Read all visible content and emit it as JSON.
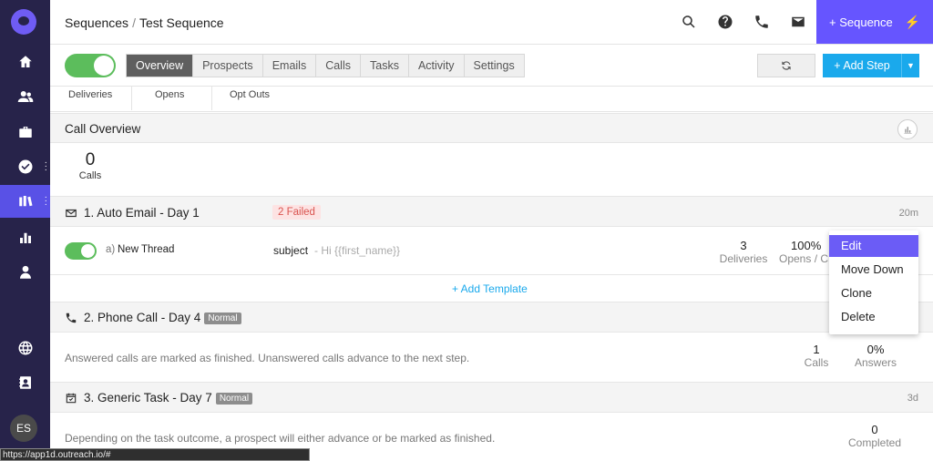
{
  "breadcrumb": {
    "parent": "Sequences",
    "separator": "/",
    "current": "Test Sequence"
  },
  "topbar": {
    "sequence_button": "+ Sequence",
    "bolt": "⚡"
  },
  "toolbar": {
    "tabs": [
      "Overview",
      "Prospects",
      "Emails",
      "Calls",
      "Tasks",
      "Activity",
      "Settings"
    ],
    "add_step": "+ Add Step"
  },
  "metrics_head": {
    "labels": [
      "Deliveries",
      "Opens",
      "Opt Outs"
    ]
  },
  "call_overview": {
    "title": "Call Overview",
    "calls_value": "0",
    "calls_label": "Calls"
  },
  "step1": {
    "title": "1. Auto Email - Day 1",
    "failed_badge": "2 Failed",
    "time": "20m",
    "thread_prefix": "a)",
    "thread_name": "New Thread",
    "subject_label": "subject",
    "subject_value": "- Hi {{first_name}}",
    "deliveries_value": "3",
    "deliveries_label": "Deliveries",
    "opens_value": "100%",
    "opens_label": "Opens / C",
    "add_template": "+ Add Template"
  },
  "step2": {
    "title": "2. Phone Call - Day 4",
    "badge": "Normal",
    "description": "Answered calls are marked as finished. Unanswered calls advance to the next step.",
    "calls_value": "1",
    "calls_label": "Calls",
    "answers_value": "0%",
    "answers_label": "Answers"
  },
  "step3": {
    "title": "3. Generic Task - Day 7",
    "badge": "Normal",
    "time": "3d",
    "description": "Depending on the task outcome, a prospect will either advance or be marked as finished.",
    "completed_value": "0",
    "completed_label": "Completed"
  },
  "context_menu": {
    "items": [
      "Edit",
      "Move Down",
      "Clone",
      "Delete"
    ]
  },
  "sidebar": {
    "avatar_initials": "ES"
  },
  "status_url": "https://app1d.outreach.io/#",
  "colors": {
    "sidebar_bg": "#27234a",
    "accent": "#6655ff",
    "toggle_on": "#5cbd5c",
    "add_step": "#1aa9ec"
  }
}
